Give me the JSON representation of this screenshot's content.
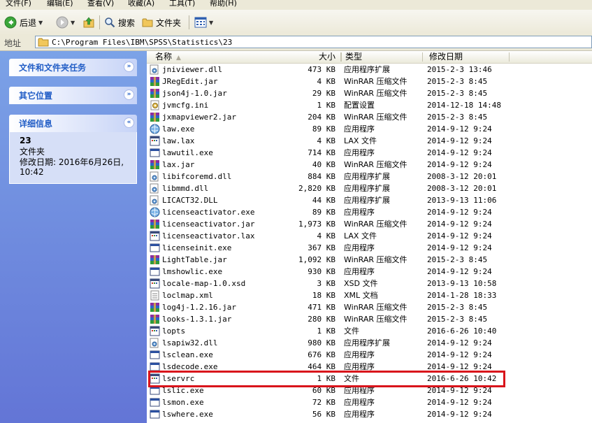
{
  "menu": [
    "文件(F)",
    "编辑(E)",
    "查看(V)",
    "收藏(A)",
    "工具(T)",
    "帮助(H)"
  ],
  "toolbar": {
    "back_label": "后退",
    "search_label": "搜索",
    "folders_label": "文件夹"
  },
  "address": {
    "label": "地址",
    "path": "C:\\Program Files\\IBM\\SPSS\\Statistics\\23"
  },
  "taskpane": {
    "file_tasks_title": "文件和文件夹任务",
    "other_places_title": "其它位置",
    "details_title": "详细信息",
    "details": {
      "name": "23",
      "type": "文件夹",
      "modified": "修改日期: 2016年6月26日, 10:42"
    }
  },
  "columns": {
    "name": "名称",
    "size": "大小",
    "type": "类型",
    "modified": "修改日期"
  },
  "files": [
    {
      "name": "jniviewer.dll",
      "size": "473 KB",
      "type": "应用程序扩展",
      "date": "2015-2-3 13:46",
      "icon": "dll-icon"
    },
    {
      "name": "JRegEdit.jar",
      "size": "4 KB",
      "type": "WinRAR 压缩文件",
      "date": "2015-2-3 8:45",
      "icon": "winrar-icon"
    },
    {
      "name": "json4j-1.0.jar",
      "size": "29 KB",
      "type": "WinRAR 压缩文件",
      "date": "2015-2-3 8:45",
      "icon": "winrar-icon"
    },
    {
      "name": "jvmcfg.ini",
      "size": "1 KB",
      "type": "配置设置",
      "date": "2014-12-18 14:48",
      "icon": "ini-icon"
    },
    {
      "name": "jxmapviewer2.jar",
      "size": "204 KB",
      "type": "WinRAR 压缩文件",
      "date": "2015-2-3 8:45",
      "icon": "winrar-icon"
    },
    {
      "name": "law.exe",
      "size": "89 KB",
      "type": "应用程序",
      "date": "2014-9-12 9:24",
      "icon": "globe-exe-icon"
    },
    {
      "name": "law.lax",
      "size": "4 KB",
      "type": "LAX 文件",
      "date": "2014-9-12 9:24",
      "icon": "generic-file-icon"
    },
    {
      "name": "lawutil.exe",
      "size": "714 KB",
      "type": "应用程序",
      "date": "2014-9-12 9:24",
      "icon": "exe-window-icon"
    },
    {
      "name": "lax.jar",
      "size": "40 KB",
      "type": "WinRAR 压缩文件",
      "date": "2014-9-12 9:24",
      "icon": "winrar-icon"
    },
    {
      "name": "libifcoremd.dll",
      "size": "884 KB",
      "type": "应用程序扩展",
      "date": "2008-3-12 20:01",
      "icon": "dll-icon"
    },
    {
      "name": "libmmd.dll",
      "size": "2,820 KB",
      "type": "应用程序扩展",
      "date": "2008-3-12 20:01",
      "icon": "dll-icon"
    },
    {
      "name": "LICACT32.DLL",
      "size": "44 KB",
      "type": "应用程序扩展",
      "date": "2013-9-13 11:06",
      "icon": "dll-icon"
    },
    {
      "name": "licenseactivator.exe",
      "size": "89 KB",
      "type": "应用程序",
      "date": "2014-9-12 9:24",
      "icon": "globe-exe-icon"
    },
    {
      "name": "licenseactivator.jar",
      "size": "1,973 KB",
      "type": "WinRAR 压缩文件",
      "date": "2014-9-12 9:24",
      "icon": "winrar-icon"
    },
    {
      "name": "licenseactivator.lax",
      "size": "4 KB",
      "type": "LAX 文件",
      "date": "2014-9-12 9:24",
      "icon": "generic-file-icon"
    },
    {
      "name": "licenseinit.exe",
      "size": "367 KB",
      "type": "应用程序",
      "date": "2014-9-12 9:24",
      "icon": "exe-window-icon"
    },
    {
      "name": "LightTable.jar",
      "size": "1,092 KB",
      "type": "WinRAR 压缩文件",
      "date": "2015-2-3 8:45",
      "icon": "winrar-icon"
    },
    {
      "name": "lmshowlic.exe",
      "size": "930 KB",
      "type": "应用程序",
      "date": "2014-9-12 9:24",
      "icon": "exe-window-icon"
    },
    {
      "name": "locale-map-1.0.xsd",
      "size": "3 KB",
      "type": "XSD 文件",
      "date": "2013-9-13 10:58",
      "icon": "generic-file-icon"
    },
    {
      "name": "loclmap.xml",
      "size": "18 KB",
      "type": "XML 文档",
      "date": "2014-1-28 18:33",
      "icon": "xml-icon"
    },
    {
      "name": "log4j-1.2.16.jar",
      "size": "471 KB",
      "type": "WinRAR 压缩文件",
      "date": "2015-2-3 8:45",
      "icon": "winrar-icon"
    },
    {
      "name": "looks-1.3.1.jar",
      "size": "280 KB",
      "type": "WinRAR 压缩文件",
      "date": "2015-2-3 8:45",
      "icon": "winrar-icon"
    },
    {
      "name": "lopts",
      "size": "1 KB",
      "type": "文件",
      "date": "2016-6-26 10:40",
      "icon": "generic-file-icon"
    },
    {
      "name": "lsapiw32.dll",
      "size": "980 KB",
      "type": "应用程序扩展",
      "date": "2014-9-12 9:24",
      "icon": "dll-icon"
    },
    {
      "name": "lsclean.exe",
      "size": "676 KB",
      "type": "应用程序",
      "date": "2014-9-12 9:24",
      "icon": "exe-window-icon"
    },
    {
      "name": "lsdecode.exe",
      "size": "464 KB",
      "type": "应用程序",
      "date": "2014-9-12 9:24",
      "icon": "exe-window-icon"
    },
    {
      "name": "lservrc",
      "size": "1 KB",
      "type": "文件",
      "date": "2016-6-26 10:42",
      "icon": "generic-file-icon"
    },
    {
      "name": "lslic.exe",
      "size": "60 KB",
      "type": "应用程序",
      "date": "2014-9-12 9:24",
      "icon": "exe-window-icon"
    },
    {
      "name": "lsmon.exe",
      "size": "72 KB",
      "type": "应用程序",
      "date": "2014-9-12 9:24",
      "icon": "exe-window-icon"
    },
    {
      "name": "lswhere.exe",
      "size": "56 KB",
      "type": "应用程序",
      "date": "2014-9-12 9:24",
      "icon": "exe-window-icon"
    }
  ],
  "colors": {
    "taskpane_top": "#7ba2e7",
    "taskpane_bottom": "#6375d6",
    "highlight": "#d9141b",
    "header_text": "#215dc6"
  }
}
